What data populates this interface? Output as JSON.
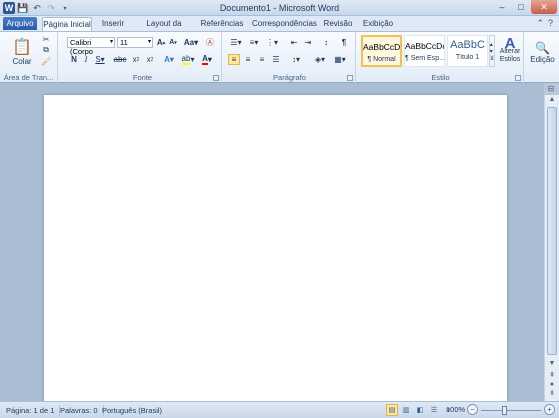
{
  "window": {
    "title": "Documento1  -  Microsoft Word",
    "qat": {
      "app_icon": "word-icon",
      "save_icon": "save-icon",
      "undo_icon": "undo-icon",
      "redo_icon": "redo-icon",
      "customize_icon": "customize-qat-icon"
    },
    "controls": {
      "minimize": "–",
      "maximize": "□",
      "close": "✕"
    }
  },
  "tabs": {
    "file": "Arquivo",
    "items": [
      "Página Inicial",
      "Inserir",
      "Layout da Página",
      "Referências",
      "Correspondências",
      "Revisão",
      "Exibição"
    ],
    "active": "Página Inicial"
  },
  "ribbon": {
    "clipboard": {
      "label": "Área de Tran...",
      "paste": "Colar"
    },
    "font": {
      "label": "Fonte",
      "font_name": "Calibri (Corpo",
      "font_size": "11"
    },
    "paragraph": {
      "label": "Parágrafo"
    },
    "styles": {
      "label": "Estilo",
      "items": [
        {
          "sample": "AaBbCcDc",
          "name": "¶ Normal"
        },
        {
          "sample": "AaBbCcDc",
          "name": "¶ Sem Esp..."
        },
        {
          "sample": "AaBbC",
          "name": "Título 1"
        }
      ],
      "change_styles": "Alterar Estilos"
    },
    "editing": {
      "label": "Edição"
    }
  },
  "statusbar": {
    "page": "Página: 1 de 1",
    "words": "Palavras: 0",
    "language": "Português (Brasil)",
    "zoom": "100%"
  },
  "colors": {
    "accent": "#2b579a",
    "highlight": "#ffff00",
    "font_color": "#ff0000"
  }
}
